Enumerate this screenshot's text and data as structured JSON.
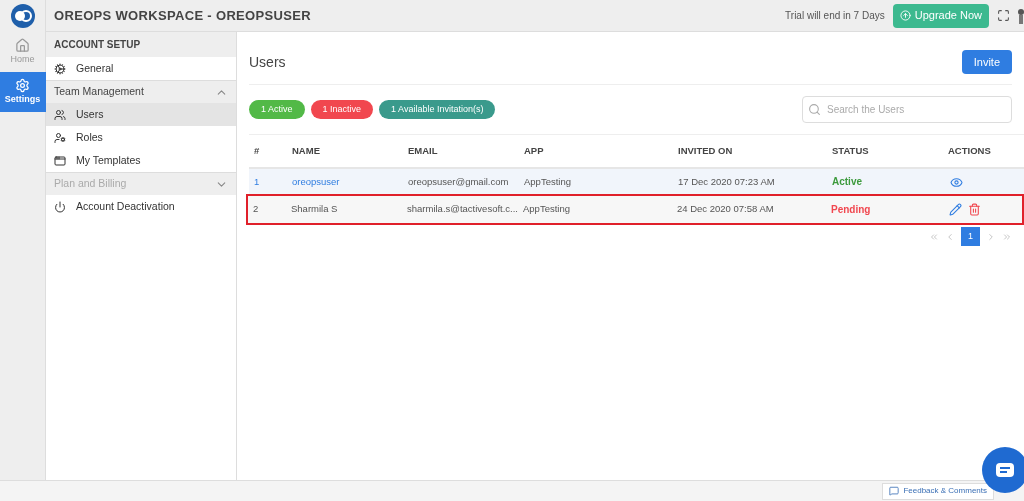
{
  "rail": [
    {
      "label": "Home",
      "kind": "home",
      "selected": false
    },
    {
      "label": "Settings",
      "kind": "settings",
      "selected": true
    }
  ],
  "topbar": {
    "title": "OREOPS WORKSPACE - OREOPSUSER",
    "trial": "Trial will end in 7 Days",
    "upgrade": "Upgrade Now"
  },
  "sidebar": {
    "heading": "ACCOUNT SETUP",
    "items": [
      {
        "kind": "item",
        "label": "General",
        "selected": false
      },
      {
        "kind": "section",
        "label": "Team Management",
        "expanded": true,
        "disabled": false
      },
      {
        "kind": "item",
        "label": "Users",
        "selected": true
      },
      {
        "kind": "item",
        "label": "Roles",
        "selected": false
      },
      {
        "kind": "item",
        "label": "My Templates",
        "selected": false
      },
      {
        "kind": "section",
        "label": "Plan and Billing",
        "expanded": false,
        "disabled": true
      },
      {
        "kind": "item",
        "label": "Account Deactivation",
        "selected": false
      }
    ]
  },
  "page": {
    "title": "Users",
    "invite": "Invite",
    "search": {
      "placeholder": "Search the Users"
    },
    "badges": [
      {
        "label": "1 Active",
        "color": "#52b947"
      },
      {
        "label": "1 Inactive",
        "color": "#f1474f"
      },
      {
        "label": "1 Available Invitation(s)",
        "color": "#3a9a8c"
      }
    ]
  },
  "table": {
    "columns": [
      "#",
      "NAME",
      "EMAIL",
      "APP",
      "INVITED ON",
      "STATUS",
      "ACTIONS"
    ],
    "rows": [
      {
        "index": "1",
        "name": "oreopsuser",
        "email": "oreopsuser@gmail.com",
        "app": "AppTesting",
        "invited_on": "17 Dec 2020 07:23 AM",
        "status": {
          "label": "Active",
          "color": "#3c9a3c"
        },
        "actions": [
          {
            "kind": "view"
          }
        ],
        "highlighted": false
      },
      {
        "index": "2",
        "name": "Sharmila S",
        "email": "sharmila.s@tactivesoft.c...",
        "app": "AppTesting",
        "invited_on": "24 Dec 2020 07:58 AM",
        "status": {
          "label": "Pending",
          "color": "#f1474f"
        },
        "actions": [
          {
            "kind": "edit"
          },
          {
            "kind": "delete"
          }
        ],
        "highlighted": true
      }
    ]
  },
  "pagination": {
    "pages": [
      {
        "label": "1",
        "selected": true
      }
    ]
  },
  "footer": {
    "feedback": "Feedback & Comments"
  }
}
